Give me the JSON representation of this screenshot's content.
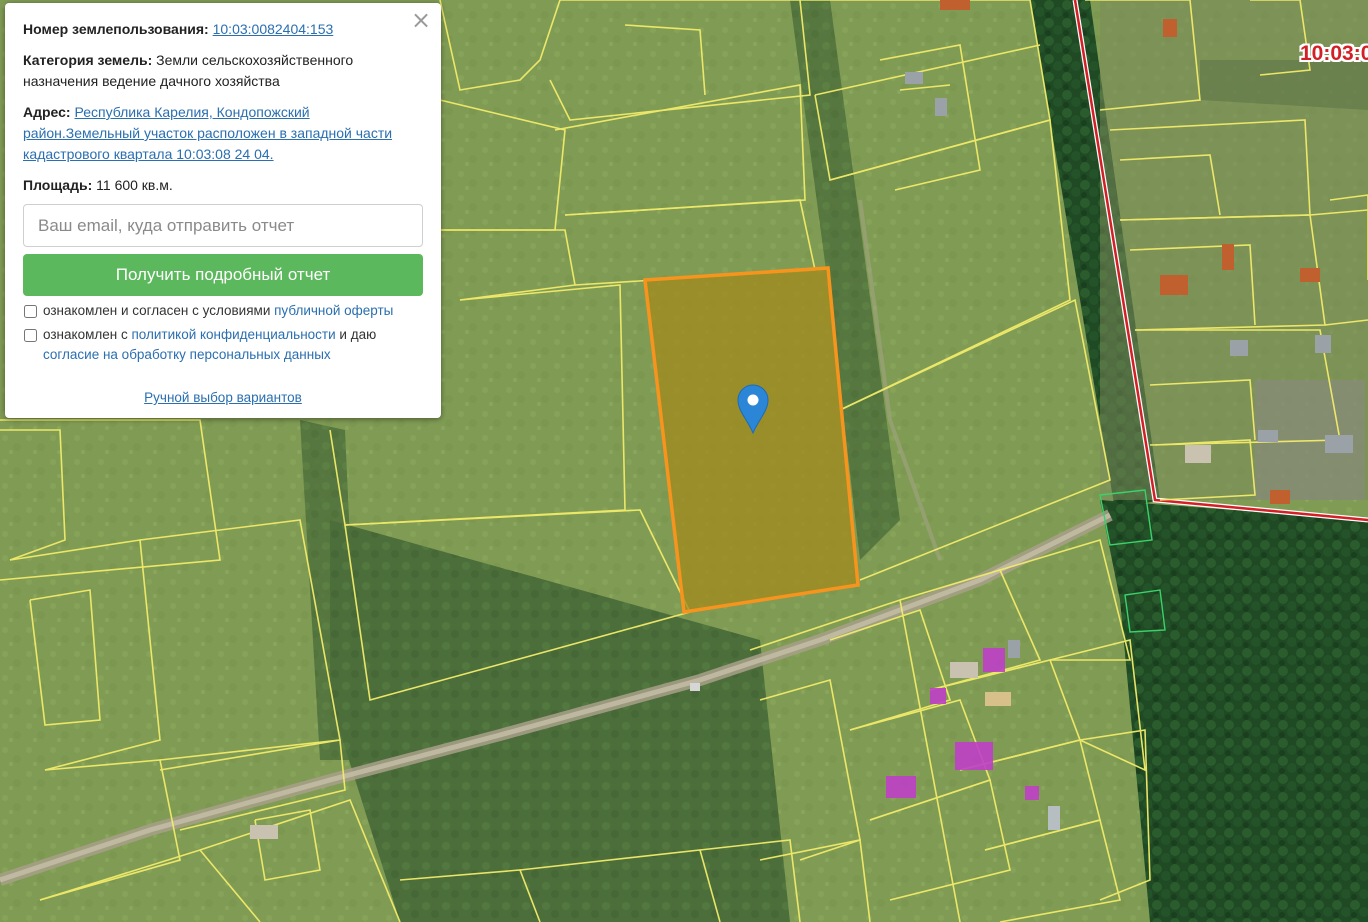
{
  "popup": {
    "close_symbol": "×",
    "number_label": "Номер землепользования:",
    "number_value": "10:03:0082404:153",
    "category_label": "Категория земель:",
    "category_value": "Земли сельскохозяйственного назначения ведение дачного хозяйства",
    "address_label": "Адрес:",
    "address_value": "Республика Карелия, Кондопожский район.Земельный участок расположен в западной части кадастрового квартала 10:03:08 24 04.",
    "area_label": "Площадь:",
    "area_value": "11 600 кв.м.",
    "email_placeholder": "Ваш email, куда отправить отчет",
    "report_button": "Получить подробный отчет",
    "offer_text": "ознакомлен и согласен с условиями",
    "offer_link": "публичной оферты",
    "privacy_text_1": "ознакомлен с",
    "privacy_link": "политикой конфиденциальности",
    "privacy_text_2": "и даю",
    "consent_link": "согласие на обработку персональных данных",
    "manual_link": "Ручной выбор вариантов",
    "button_color": "#5cb85c",
    "link_color": "#2a6fb0"
  },
  "map": {
    "quarter_label": "10:03:0",
    "selected_parcel_color": "#f7941d",
    "parcel_line_color": "#f2ec6b",
    "quarter_border_color": "#d31f26",
    "marker_color": "#2c86d8",
    "marker_icon": "map-pin-icon"
  }
}
